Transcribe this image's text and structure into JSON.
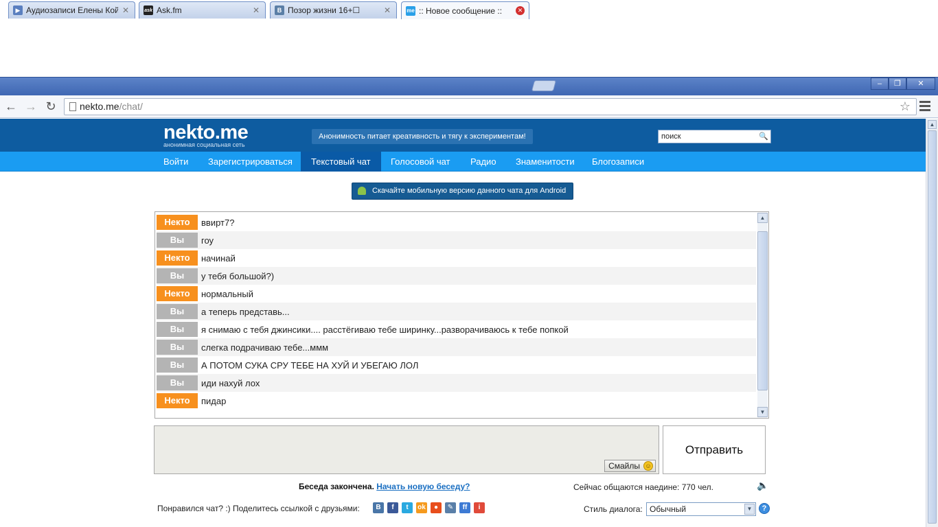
{
  "browser": {
    "tabs": [
      {
        "title": "Аудиозаписи Елены Койпиш",
        "favicon": "▶",
        "favicon_color": "#5a7fbf"
      },
      {
        "title": "Ask.fm",
        "favicon": "ask",
        "favicon_color": "#222222"
      },
      {
        "title": "Позор жизни 16+☐",
        "favicon": "B",
        "favicon_color": "#5b7fa6"
      },
      {
        "title": ":: Новое сообщение ::",
        "favicon": "me",
        "favicon_color": "#2aa0e8"
      }
    ],
    "url_host": "nekto.me",
    "url_path": "/chat/",
    "window_controls": {
      "minimize": "–",
      "restore": "❐",
      "close": "✕"
    }
  },
  "site": {
    "logo": "nekto.me",
    "logo_sub": "анонимная социальная сеть",
    "slogan": "Анонимность питает креативность и тягу к экспериментам!",
    "search_placeholder": "поиск",
    "nav": [
      "Войти",
      "Зарегистрироваться",
      "Текстовый чат",
      "Голосовой чат",
      "Радио",
      "Знаменитости",
      "Блогозаписи"
    ],
    "nav_active": "Текстовый чат",
    "android_button": "Скачайте мобильную версию данного чата для Android"
  },
  "chat": {
    "labels": {
      "nekto": "Некто",
      "you": "Вы"
    },
    "messages": [
      {
        "from": "Некто",
        "text": "ввирт7?"
      },
      {
        "from": "Вы",
        "text": "гоу"
      },
      {
        "from": "Некто",
        "text": "начинай"
      },
      {
        "from": "Вы",
        "text": "у тебя большой?)"
      },
      {
        "from": "Некто",
        "text": "нормальный"
      },
      {
        "from": "Вы",
        "text": "а теперь представь..."
      },
      {
        "from": "Вы",
        "text": "я снимаю с тебя джинсики.... расстёгиваю тебе ширинку...разворачиваюсь к тебе попкой"
      },
      {
        "from": "Вы",
        "text": "слегка подрачиваю тебе...ммм"
      },
      {
        "from": "Вы",
        "text": "А ПОТОМ СУКА СРУ ТЕБЕ НА ХУЙ И УБЕГАЮ ЛОЛ"
      },
      {
        "from": "Вы",
        "text": "иди нахуй лох"
      },
      {
        "from": "Некто",
        "text": "пидар"
      }
    ],
    "smileys_label": "Смайлы",
    "send_label": "Отправить",
    "ended_text": "Беседа закончена.",
    "new_chat_link": "Начать новую беседу?",
    "online_text": "Сейчас общаются наедине: 770 чел.",
    "share_text": "Понравился чат? :) Поделитесь ссылкой с друзьями:",
    "share_icons": [
      {
        "name": "vk-icon",
        "glyph": "В",
        "color": "#4a76a8"
      },
      {
        "name": "facebook-icon",
        "glyph": "f",
        "color": "#3b5998"
      },
      {
        "name": "twitter-icon",
        "glyph": "t",
        "color": "#2aa9e0"
      },
      {
        "name": "odnoklassniki-icon",
        "glyph": "ok",
        "color": "#f59a1e"
      },
      {
        "name": "moimir-icon",
        "glyph": "●",
        "color": "#e84e1c"
      },
      {
        "name": "livejournal-icon",
        "glyph": "✎",
        "color": "#5a7fa8"
      },
      {
        "name": "friendfeed-icon",
        "glyph": "ff",
        "color": "#3d7ad4"
      },
      {
        "name": "moikrug-icon",
        "glyph": "i",
        "color": "#e04a3a"
      }
    ],
    "style_label": "Стиль диалога:",
    "style_value": "Обычный"
  },
  "colors": {
    "header_bg": "#0e5ca0",
    "nav_bg": "#1a9cf2",
    "nekto_badge": "#f7901e",
    "you_badge": "#b4b4b4"
  }
}
